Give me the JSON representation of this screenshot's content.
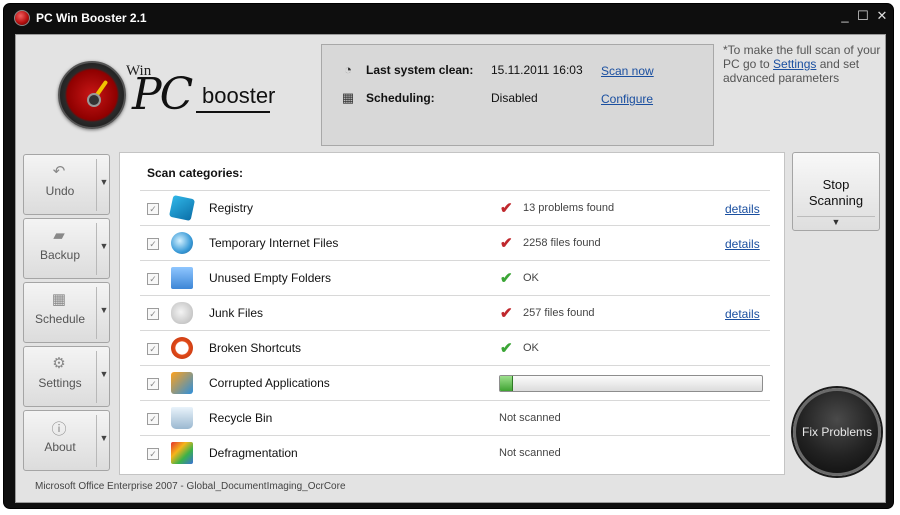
{
  "window": {
    "title": "PC Win Booster 2.1",
    "controls": {
      "minimize": "_",
      "maximize": "☐",
      "close": "✕"
    }
  },
  "logo": {
    "win": "Win",
    "pc": "PC",
    "booster": "booster"
  },
  "info": {
    "last_clean_label": "Last system clean:",
    "last_clean_value": "15.11.2011  16:03",
    "scan_now": "Scan now",
    "scheduling_label": "Scheduling:",
    "scheduling_value": "Disabled",
    "configure": "Configure"
  },
  "hint": {
    "before": "*To make the full scan of your PC go to ",
    "link": "Settings",
    "after": " and set advanced parameters"
  },
  "sidebar": [
    {
      "label": "Undo",
      "icon": "undo-icon"
    },
    {
      "label": "Backup",
      "icon": "backup-icon"
    },
    {
      "label": "Schedule",
      "icon": "schedule-icon"
    },
    {
      "label": "Settings",
      "icon": "settings-icon"
    },
    {
      "label": "About",
      "icon": "about-icon"
    }
  ],
  "scan": {
    "title": "Scan categories:",
    "details_label": "details",
    "rows": [
      {
        "label": "Registry",
        "icon": "registry-icon",
        "status": "13 problems found",
        "status_type": "problem",
        "details": true
      },
      {
        "label": "Temporary Internet Files",
        "icon": "internet-files-icon",
        "status": "2258 files found",
        "status_type": "problem",
        "details": true
      },
      {
        "label": "Unused Empty Folders",
        "icon": "folder-warning-icon",
        "status": "OK",
        "status_type": "ok",
        "details": false
      },
      {
        "label": "Junk Files",
        "icon": "junk-files-icon",
        "status": "257 files found",
        "status_type": "problem",
        "details": true
      },
      {
        "label": "Broken Shortcuts",
        "icon": "broken-shortcut-icon",
        "status": "OK",
        "status_type": "ok",
        "details": false
      },
      {
        "label": "Corrupted Applications",
        "icon": "corrupted-apps-icon",
        "status": "",
        "status_type": "progress",
        "progress": 0.05,
        "details": false
      },
      {
        "label": "Recycle Bin",
        "icon": "recycle-bin-icon",
        "status": "Not scanned",
        "status_type": "none",
        "details": false
      },
      {
        "label": "Defragmentation",
        "icon": "defragmentation-icon",
        "status": "Not scanned",
        "status_type": "none",
        "details": false
      }
    ]
  },
  "buttons": {
    "stop_line1": "Stop",
    "stop_line2": "Scanning",
    "fix": "Fix Problems"
  },
  "footer": "Microsoft Office Enterprise 2007 - Global_DocumentImaging_OcrCore",
  "colors": {
    "link": "#1a4fa0",
    "problem": "#c0282d",
    "ok": "#3aa535",
    "progress": "#3fa332"
  }
}
